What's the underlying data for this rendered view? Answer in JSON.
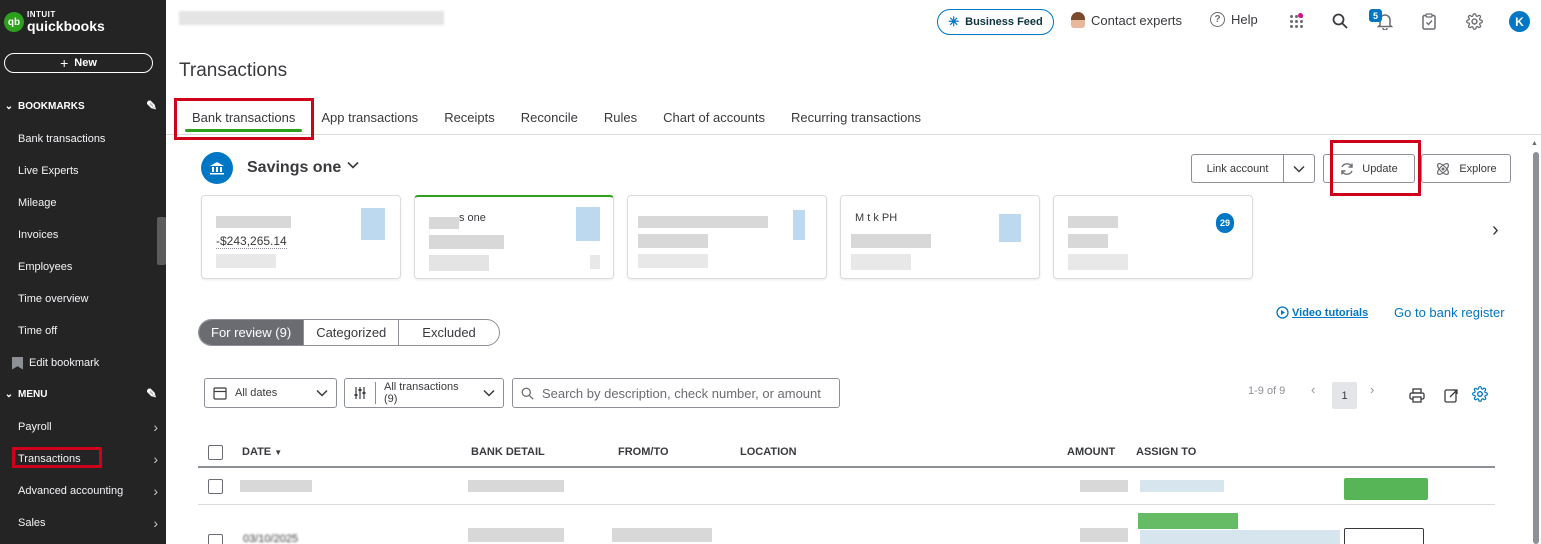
{
  "brand": {
    "intuit": "INTUIT",
    "name": "quickbooks",
    "mark": "qb"
  },
  "sidebar": {
    "new_label": "New",
    "bookmarks_header": "BOOKMARKS",
    "bookmarks": [
      {
        "label": "Bank transactions"
      },
      {
        "label": "Live Experts"
      },
      {
        "label": "Mileage"
      },
      {
        "label": "Invoices"
      },
      {
        "label": "Employees"
      },
      {
        "label": "Time overview"
      },
      {
        "label": "Time off"
      }
    ],
    "edit_bookmark": "Edit bookmark",
    "menu_header": "MENU",
    "menu": [
      {
        "label": "Payroll"
      },
      {
        "label": "Transactions"
      },
      {
        "label": "Advanced accounting"
      },
      {
        "label": "Sales"
      }
    ]
  },
  "topbar": {
    "business_feed": "Business Feed",
    "contact_experts": "Contact experts",
    "help": "Help",
    "notifications_count": "5",
    "avatar_initial": "K"
  },
  "page": {
    "title": "Transactions"
  },
  "tabs": [
    {
      "label": "Bank transactions"
    },
    {
      "label": "App transactions"
    },
    {
      "label": "Receipts"
    },
    {
      "label": "Reconcile"
    },
    {
      "label": "Rules"
    },
    {
      "label": "Chart of accounts"
    },
    {
      "label": "Recurring transactions"
    }
  ],
  "account": {
    "name": "Savings one",
    "link_account": "Link account",
    "update": "Update",
    "explore": "Explore"
  },
  "cards": [
    {
      "amount": "-$243,265.14"
    },
    {
      "name": "s one"
    },
    {
      "name": ""
    },
    {
      "name": "M t    k PH"
    },
    {
      "badge": "29"
    }
  ],
  "links": {
    "video_tutorials": "Video tutorials",
    "bank_register": "Go to bank register"
  },
  "review_filter": [
    {
      "label": "For review (9)"
    },
    {
      "label": "Categorized"
    },
    {
      "label": "Excluded"
    }
  ],
  "filters": {
    "dates": "All dates",
    "transactions": "All transactions (9)",
    "search_placeholder": "Search by description, check number, or amount"
  },
  "pagination": {
    "range": "1-9 of 9",
    "current_page": "1"
  },
  "table": {
    "columns": [
      "DATE",
      "BANK DETAIL",
      "FROM/TO",
      "LOCATION",
      "AMOUNT",
      "ASSIGN TO"
    ],
    "partial_date": "03/10/2025"
  },
  "colors": {
    "accent": "#0077c5",
    "green": "#2ca01c",
    "highlight": "#d0021b",
    "sidebar": "#242424"
  }
}
